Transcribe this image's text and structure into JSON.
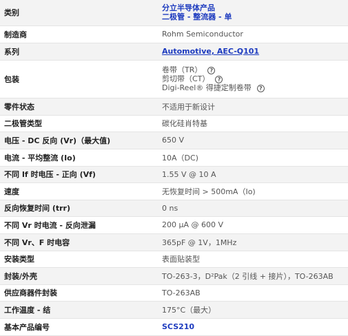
{
  "rows": [
    {
      "label": "类别",
      "lines": [
        "分立半导体产品",
        "二极管 - 整流器 - 单"
      ],
      "link": true
    },
    {
      "label": "制造商",
      "value": "Rohm Semiconductor"
    },
    {
      "label": "系列",
      "value": "Automotive, AEC-Q101",
      "link": true
    },
    {
      "label": "包装",
      "lines": [
        "卷带（TR）",
        "剪切带（CT）",
        "Digi-Reel® 得捷定制卷带"
      ],
      "help_icon": "question-circle-icon"
    },
    {
      "label": "零件状态",
      "value": "不适用于新设计"
    },
    {
      "label": "二极管类型",
      "value": "碳化硅肖特基"
    },
    {
      "label": "电压 - DC 反向 (Vr)（最大值)",
      "value": "650 V"
    },
    {
      "label": "电流 - 平均整流 (Io)",
      "value": "10A（DC)"
    },
    {
      "label": "不同 If 时电压 - 正向 (Vf)",
      "value": "1.55 V @ 10 A"
    },
    {
      "label": "速度",
      "value": "无恢复时间 > 500mA（Io)"
    },
    {
      "label": "反向恢复时间 (trr)",
      "value": "0 ns"
    },
    {
      "label": "不同 Vr 时电流 - 反向泄漏",
      "value": "200 µA @ 600 V"
    },
    {
      "label": "不同 Vr、F 时电容",
      "value": "365pF @ 1V，1MHz"
    },
    {
      "label": "安装类型",
      "value": "表面贴装型"
    },
    {
      "label": "封装/外壳",
      "value": "TO-263-3，D²Pak（2 引线 + 接片），TO-263AB"
    },
    {
      "label": "供应商器件封装",
      "value": "TO-263AB"
    },
    {
      "label": "工作温度 - 结",
      "value": "175°C（最大）"
    },
    {
      "label": "基本产品编号",
      "value": "SCS210",
      "link": true
    }
  ]
}
